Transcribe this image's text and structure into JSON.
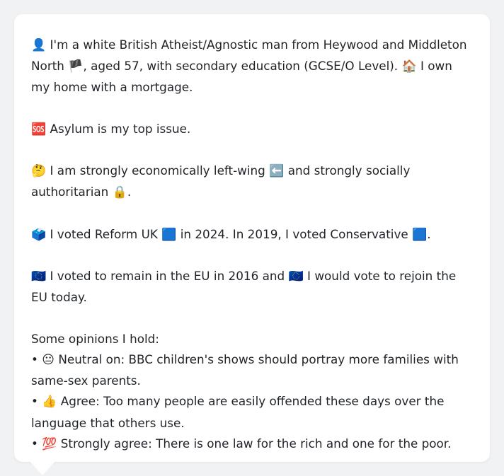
{
  "profile": {
    "intro_emoji": "👤",
    "intro_text": "I'm a white British Atheist/Agnostic man from Heywood and Middleton North",
    "flag_emoji": "🏴",
    "intro_text2": ", aged 57, with secondary education (GCSE/O Level).",
    "home_emoji": "🏠",
    "home_text": "I own my home with a mortgage.",
    "issue_emoji": "🆘",
    "issue_text": "Asylum is my top issue.",
    "think_emoji": "🤔",
    "politics_text1": "I am strongly economically left-wing",
    "left_emoji": "⬅️",
    "politics_text2": "and strongly socially authoritarian",
    "lock_emoji": "🔒",
    "politics_end": ".",
    "ballot_emoji": "🗳️",
    "vote_text1": "I voted Reform UK",
    "blue_square_emoji": "🟦",
    "vote_text2": "in 2024. In 2019, I voted Conservative",
    "vote_end": ".",
    "eu_emoji": "🇪🇺",
    "eu_text1": "I voted to remain in the EU in 2016 and",
    "eu_text2": "I would vote to rejoin the EU today.",
    "opinions_heading": "Some opinions I hold:",
    "opinions": [
      {
        "bullet": "•",
        "emoji": "😐",
        "text": "Neutral on: BBC children's shows should portray more families with same-sex parents."
      },
      {
        "bullet": "•",
        "emoji": "👍",
        "text": "Agree: Too many people are easily offended these days over the language that others use."
      },
      {
        "bullet": "•",
        "emoji": "💯",
        "text": "Strongly agree: There is one law for the rich and one for the poor."
      }
    ]
  }
}
